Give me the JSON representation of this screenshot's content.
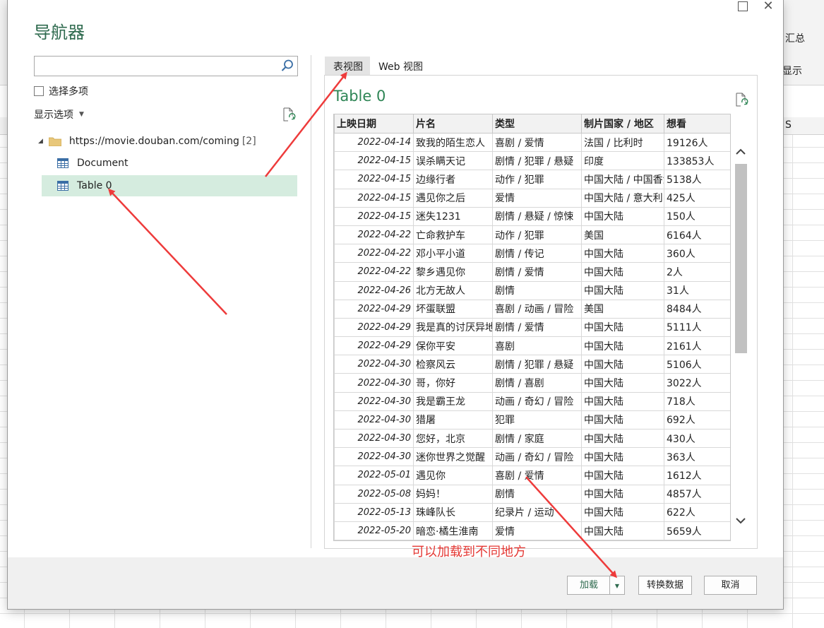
{
  "dialog": {
    "title": "导航器",
    "search": {
      "value": "",
      "placeholder": ""
    },
    "select_multiple": "选择多项",
    "display_options": "显示选项",
    "tree": {
      "root_url": "https://movie.douban.com/coming",
      "root_count": "[2]",
      "items": [
        "Document",
        "Table 0"
      ]
    },
    "tabs": [
      "表视图",
      "Web 视图"
    ],
    "preview_title": "Table 0",
    "table": {
      "columns": [
        "上映日期",
        "片名",
        "类型",
        "制片国家 / 地区",
        "想看"
      ],
      "rows": [
        [
          "2022-04-14",
          "致我的陌生恋人",
          "喜剧 / 爱情",
          "法国 / 比利时",
          "19126人"
        ],
        [
          "2022-04-15",
          "误杀瞒天记",
          "剧情 / 犯罪 / 悬疑",
          "印度",
          "133853人"
        ],
        [
          "2022-04-15",
          "边缘行者",
          "动作 / 犯罪",
          "中国大陆 / 中国香港",
          "5138人"
        ],
        [
          "2022-04-15",
          "遇见你之后",
          "爱情",
          "中国大陆 / 意大利",
          "425人"
        ],
        [
          "2022-04-15",
          "迷失1231",
          "剧情 / 悬疑 / 惊悚",
          "中国大陆",
          "150人"
        ],
        [
          "2022-04-22",
          "亡命救护车",
          "动作 / 犯罪",
          "美国",
          "6164人"
        ],
        [
          "2022-04-22",
          "邓小平小道",
          "剧情 / 传记",
          "中国大陆",
          "360人"
        ],
        [
          "2022-04-22",
          "黎乡遇见你",
          "剧情 / 爱情",
          "中国大陆",
          "2人"
        ],
        [
          "2022-04-26",
          "北方无故人",
          "剧情",
          "中国大陆",
          "31人"
        ],
        [
          "2022-04-29",
          "坏蛋联盟",
          "喜剧 / 动画 / 冒险",
          "美国",
          "8484人"
        ],
        [
          "2022-04-29",
          "我是真的讨厌异地恋",
          "剧情 / 爱情",
          "中国大陆",
          "5111人"
        ],
        [
          "2022-04-29",
          "保你平安",
          "喜剧",
          "中国大陆",
          "2161人"
        ],
        [
          "2022-04-30",
          "检察风云",
          "剧情 / 犯罪 / 悬疑",
          "中国大陆",
          "5106人"
        ],
        [
          "2022-04-30",
          "哥，你好",
          "剧情 / 喜剧",
          "中国大陆",
          "3022人"
        ],
        [
          "2022-04-30",
          "我是霸王龙",
          "动画 / 奇幻 / 冒险",
          "中国大陆",
          "718人"
        ],
        [
          "2022-04-30",
          "猎屠",
          "犯罪",
          "中国大陆",
          "692人"
        ],
        [
          "2022-04-30",
          "您好，北京",
          "剧情 / 家庭",
          "中国大陆",
          "430人"
        ],
        [
          "2022-04-30",
          "迷你世界之觉醒",
          "动画 / 奇幻 / 冒险",
          "中国大陆",
          "363人"
        ],
        [
          "2022-05-01",
          "遇见你",
          "喜剧 / 爱情",
          "中国大陆",
          "1612人"
        ],
        [
          "2022-05-08",
          "妈妈！",
          "剧情",
          "中国大陆",
          "4857人"
        ],
        [
          "2022-05-13",
          "珠峰队长",
          "纪录片 / 运动",
          "中国大陆",
          "622人"
        ],
        [
          "2022-05-20",
          "暗恋·橘生淮南",
          "爱情",
          "中国大陆",
          "5659人"
        ]
      ]
    },
    "buttons": {
      "load": "加载",
      "transform": "转换数据",
      "cancel": "取消"
    }
  },
  "annotation": "可以加载到不同地方",
  "excel_ribbon": {
    "label_summary": "汇总",
    "label_show": "显示",
    "col_label": "S"
  },
  "colors": {
    "accent_green": "#2e8555",
    "selection": "#d5ecdf",
    "annotation_red": "#e53935"
  }
}
